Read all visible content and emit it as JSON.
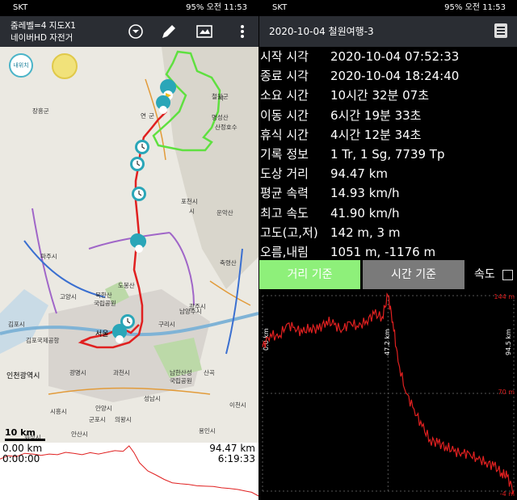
{
  "status": {
    "carrier": "SKT",
    "battery": "95%",
    "time": "오전 11:53"
  },
  "left": {
    "toolbar": {
      "line1": "줌레벨=4 지도X1",
      "line2": "네이버HD 자전거"
    },
    "map": {
      "here_button": "내위치",
      "labels": [
        {
          "t": "장흥군"
        },
        {
          "t": "연"
        },
        {
          "t": "군"
        },
        {
          "t": "철원군"
        },
        {
          "t": "명성산"
        },
        {
          "t": "산정호수"
        },
        {
          "t": "포천시"
        },
        {
          "t": "운악산"
        },
        {
          "t": "파주시"
        },
        {
          "t": "축령산"
        },
        {
          "t": "도봉산"
        },
        {
          "t": "북한산"
        },
        {
          "t": "국립공원"
        },
        {
          "t": "고양시"
        },
        {
          "t": "구리시"
        },
        {
          "t": "남양주시"
        },
        {
          "t": "광주시"
        },
        {
          "t": "김포시"
        },
        {
          "t": "김포국제공항"
        },
        {
          "t": "서울"
        },
        {
          "t": "인천광역시"
        },
        {
          "t": "광명시"
        },
        {
          "t": "과천시"
        },
        {
          "t": "안양시"
        },
        {
          "t": "군포시"
        },
        {
          "t": "의왕시"
        },
        {
          "t": "남한산성"
        },
        {
          "t": "국립공원"
        },
        {
          "t": "산곡"
        },
        {
          "t": "시흥시"
        },
        {
          "t": "안산시"
        },
        {
          "t": "성남시"
        },
        {
          "t": "용인시"
        },
        {
          "t": "화성시"
        },
        {
          "t": "이천시"
        },
        {
          "t": "시"
        },
        {
          "t": "시"
        }
      ],
      "scale": "10 km"
    },
    "mini_profile": {
      "dist_start": "0.00 km",
      "time_start": "0:00:00",
      "dist_end": "94.47 km",
      "time_end": "6:19:33"
    }
  },
  "right": {
    "title": "2020-10-04 철원여행-3",
    "stats": [
      {
        "k": "시작 시각",
        "v": "2020-10-04 07:52:33"
      },
      {
        "k": "종료 시각",
        "v": "2020-10-04 18:24:40"
      },
      {
        "k": "소요 시간",
        "v": "10시간 32분 07초"
      },
      {
        "k": "이동 시간",
        "v": "6시간 19분 33초"
      },
      {
        "k": "휴식 시간",
        "v": "4시간 12분 34초"
      },
      {
        "k": "기록 정보",
        "v": "1 Tr, 1 Sg, 7739 Tp"
      },
      {
        "k": "도상 거리",
        "v": "94.47 km"
      },
      {
        "k": "평균 속력",
        "v": "14.93 km/h"
      },
      {
        "k": "최고 속도",
        "v": "41.90 km/h"
      },
      {
        "k": "고도(고,저)",
        "v": "142 m, 3 m"
      },
      {
        "k": "오름,내림",
        "v": "1051 m, -1176 m"
      }
    ],
    "tabs": {
      "distance": "거리 기준",
      "time": "시간 기준",
      "speed": "속도"
    },
    "chart_labels": {
      "max": "144 m",
      "mid": "70 m",
      "min": "-4 m",
      "x_start": "0.0 km",
      "x_peak": "47.2 km",
      "x_end": "94.5 km"
    },
    "colors": {
      "track": "#e02020",
      "grid": "#555555",
      "tab_active": "#8ef07a"
    }
  },
  "chart_data": {
    "type": "area",
    "xlabel": "",
    "ylabel": "",
    "ylim": [
      -4,
      144
    ],
    "x": [
      0.0,
      3,
      6,
      9,
      12,
      15,
      18,
      21,
      24,
      27,
      30,
      33,
      36,
      39,
      42,
      45,
      47.2,
      49,
      51,
      54,
      57,
      60,
      63,
      66,
      69,
      72,
      75,
      78,
      81,
      84,
      87,
      90,
      92,
      94.5
    ],
    "series": [
      {
        "values": [
          105,
          115,
          112,
          122,
          120,
          116,
          120,
          118,
          125,
          122,
          118,
          124,
          120,
          125,
          130,
          128,
          144,
          124,
          94,
          70,
          58,
          45,
          35,
          32,
          30,
          26,
          25,
          24,
          20,
          18,
          15,
          10,
          7,
          -4
        ]
      }
    ]
  }
}
